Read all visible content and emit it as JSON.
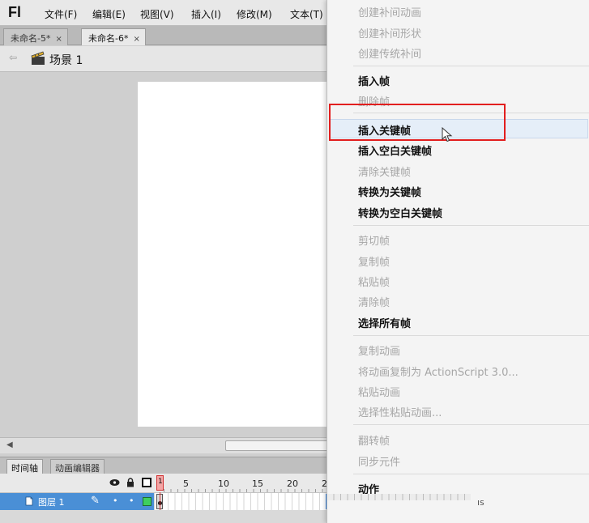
{
  "app": {
    "logo": "Fl"
  },
  "menubar": {
    "items": [
      "文件(F)",
      "编辑(E)",
      "视图(V)",
      "插入(I)",
      "修改(M)",
      "文本(T)"
    ]
  },
  "doc_tabs": [
    {
      "label": "未命名-5*",
      "close": "×"
    },
    {
      "label": "未命名-6*",
      "close": "×"
    }
  ],
  "scene": {
    "back_arrow": "⇦",
    "label": "场景 1"
  },
  "timeline": {
    "tabs": [
      "时间轴",
      "动画编辑器"
    ],
    "playhead_frame": "1",
    "frame_numbers": [
      "5",
      "10",
      "15",
      "20",
      "2"
    ],
    "layer": {
      "name": "图层 1",
      "dot": "•"
    }
  },
  "context_menu": {
    "items": [
      {
        "label": "创建补间动画",
        "enabled": false
      },
      {
        "label": "创建补间形状",
        "enabled": false
      },
      {
        "label": "创建传统补间",
        "enabled": false
      },
      {
        "label": "插入帧",
        "enabled": true
      },
      {
        "label": "删除帧",
        "enabled": false
      },
      {
        "label": "插入关键帧",
        "enabled": true
      },
      {
        "label": "插入空白关键帧",
        "enabled": true
      },
      {
        "label": "清除关键帧",
        "enabled": false
      },
      {
        "label": "转换为关键帧",
        "enabled": true
      },
      {
        "label": "转换为空白关键帧",
        "enabled": true
      },
      {
        "label": "剪切帧",
        "enabled": false
      },
      {
        "label": "复制帧",
        "enabled": false
      },
      {
        "label": "粘贴帧",
        "enabled": false
      },
      {
        "label": "清除帧",
        "enabled": false
      },
      {
        "label": "选择所有帧",
        "enabled": true
      },
      {
        "label": "复制动画",
        "enabled": false
      },
      {
        "label": "将动画复制为 ActionScript 3.0...",
        "enabled": false
      },
      {
        "label": "粘贴动画",
        "enabled": false
      },
      {
        "label": "选择性粘贴动画...",
        "enabled": false
      },
      {
        "label": "翻转帧",
        "enabled": false
      },
      {
        "label": "同步元件",
        "enabled": false
      },
      {
        "label": "动作",
        "enabled": true
      }
    ]
  },
  "tooltip_fragment": "ıs",
  "colors": {
    "highlight": "#e21e1e",
    "layer_selected": "#4a8fd6",
    "playhead": "#d23333"
  }
}
